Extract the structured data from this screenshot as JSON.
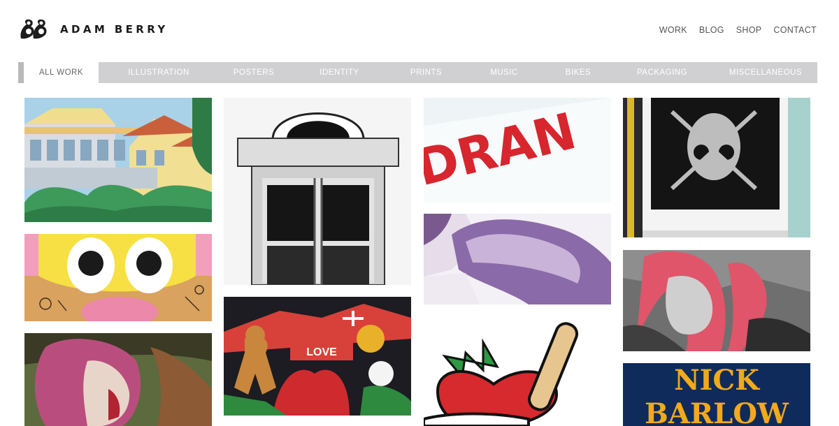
{
  "brand": {
    "name": "ADAM BERRY"
  },
  "top_nav": {
    "work": "WORK",
    "blog": "BLOG",
    "shop": "SHOP",
    "contact": "CONTACT"
  },
  "filters": {
    "all_work": "ALL WORK",
    "illustration": "ILLUSTRATION",
    "posters": "POSTERS",
    "identity": "IDENTITY",
    "prints": "PRINTS",
    "music": "MUSIC",
    "bikes": "BIKES",
    "packaging": "PACKAGING",
    "miscellaneous": "MISCELLANEOUS"
  },
  "tile_text": {
    "poster_fragment": "DRAN",
    "christmas_banner": "LOVE",
    "typography_line1": "NICK",
    "typography_line2": "BARLOW"
  },
  "colors": {
    "filter_bar": "#d0d0d2",
    "filter_active_bg": "#ffffff",
    "accent_red": "#d7262e"
  }
}
